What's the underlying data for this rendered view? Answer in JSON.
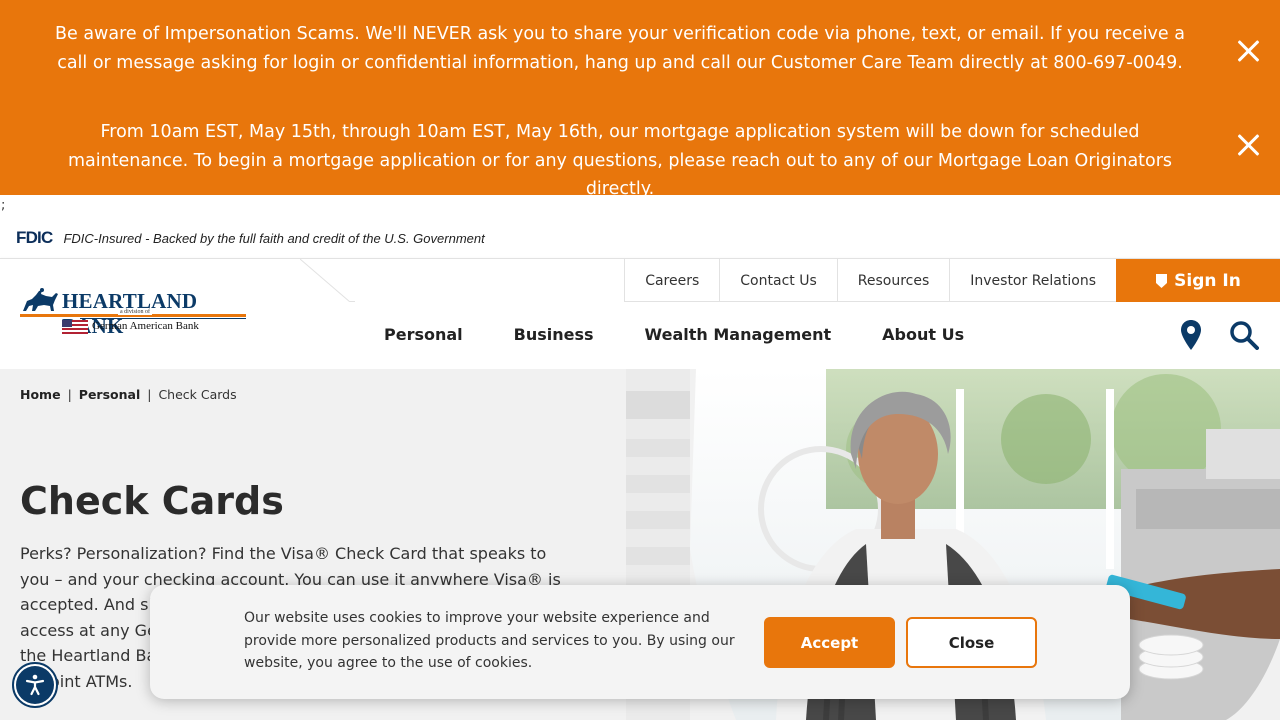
{
  "alerts": [
    {
      "text": "Be aware of Impersonation Scams. We'll NEVER ask you to share your verification code via phone, text, or email. If you receive a call or message asking for login or confidential information, hang up and call our Customer Care Team directly at 800-697-0049."
    },
    {
      "text": "From 10am EST, May 15th, through 10am EST, May 16th, our mortgage application system will be down for scheduled maintenance. To begin a mortgage application or for any questions, please reach out to any of our Mortgage Loan Originators directly."
    }
  ],
  "stray_text": ";",
  "fdic": {
    "logo": "FDIC",
    "text": "FDIC-Insured - Backed by the full faith and credit of the U.S. Government"
  },
  "logo": {
    "name": "HEARTLAND BANK",
    "division": "a division of",
    "parent": "German American Bank"
  },
  "topnav": {
    "items": [
      "Careers",
      "Contact Us",
      "Resources",
      "Investor Relations"
    ],
    "signin": "Sign In"
  },
  "mainnav": {
    "items": [
      "Personal",
      "Business",
      "Wealth Management",
      "About Us"
    ]
  },
  "breadcrumb": {
    "home": "Home",
    "personal": "Personal",
    "current": "Check Cards",
    "sep": "|"
  },
  "page": {
    "title": "Check Cards",
    "intro": "Perks? Personalization? Find the Visa® Check Card that speaks to you – and your checking account. You can use it anywhere Visa® is accepted. And since it doubles as your ATM card, you'll have 24/7 access at any German American Bank ATM, including those at both the Heartland Bank and German American Bank, and the 55,000 Allpoint ATMs."
  },
  "cookie": {
    "text": "Our website uses cookies to improve your website experience and provide more personalized products and services to you. By using our website, you agree to the use of cookies.",
    "accept": "Accept",
    "close": "Close"
  },
  "colors": {
    "accent": "#e8760c",
    "navy": "#0b3a67"
  }
}
